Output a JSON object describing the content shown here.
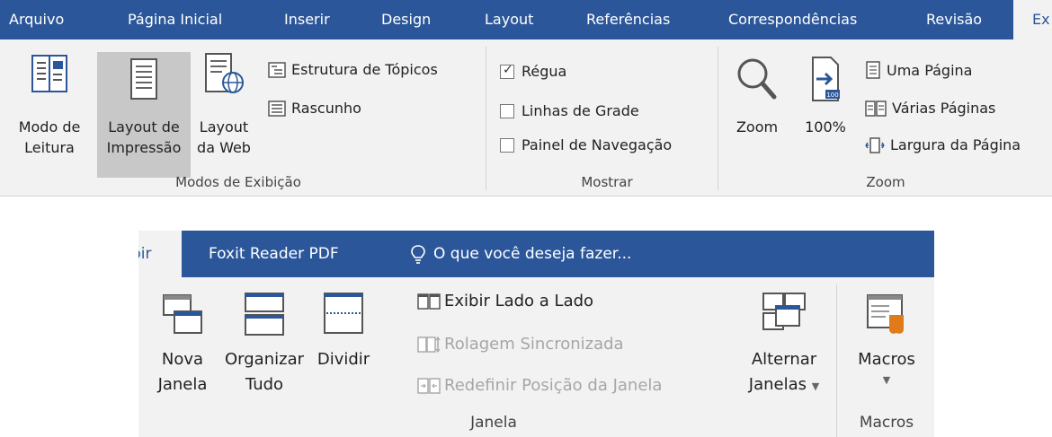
{
  "top_ribbon": {
    "tabs": [
      {
        "label": "Arquivo"
      },
      {
        "label": "Página Inicial"
      },
      {
        "label": "Inserir"
      },
      {
        "label": "Design"
      },
      {
        "label": "Layout"
      },
      {
        "label": "Referências"
      },
      {
        "label": "Correspondências"
      },
      {
        "label": "Revisão"
      },
      {
        "label": "Ex"
      }
    ],
    "groups": {
      "modos": {
        "label": "Modos de Exibição",
        "modo_leitura": [
          "Modo de",
          "Leitura"
        ],
        "layout_impressao": [
          "Layout de",
          "Impressão"
        ],
        "layout_web": [
          "Layout",
          "da Web"
        ],
        "estrutura": "Estrutura de Tópicos",
        "rascunho": "Rascunho"
      },
      "mostrar": {
        "label": "Mostrar",
        "regua": "Régua",
        "linhas_grade": "Linhas de Grade",
        "painel_navegacao": "Painel de Navegação"
      },
      "zoom": {
        "label": "Zoom",
        "zoom": "Zoom",
        "cem": "100%",
        "uma_pagina": "Uma Página",
        "varias_paginas": "Várias Páginas",
        "largura_pagina": "Largura da Página"
      }
    }
  },
  "bottom_ribbon": {
    "tabs": [
      {
        "label": "bir"
      },
      {
        "label": "Foxit Reader PDF"
      }
    ],
    "tell_me": "O que você deseja fazer...",
    "groups": {
      "janela": {
        "label": "Janela",
        "nova_janela": [
          "Nova",
          "Janela"
        ],
        "organizar_tudo": [
          "Organizar",
          "Tudo"
        ],
        "dividir": "Dividir",
        "lado_a_lado": "Exibir Lado a Lado",
        "rolagem": "Rolagem Sincronizada",
        "redefinir": "Redefinir Posição da Janela",
        "alternar": [
          "Alternar",
          "Janelas"
        ]
      },
      "macros": {
        "label": "Macros",
        "macros": "Macros"
      }
    }
  },
  "colors": {
    "ribbon_tab_bar": "#2b579a",
    "ribbon_body": "#f2f2f2",
    "selected": "#c8c8c8",
    "accent": "#2b579a",
    "macro_orange": "#e07b1a"
  }
}
